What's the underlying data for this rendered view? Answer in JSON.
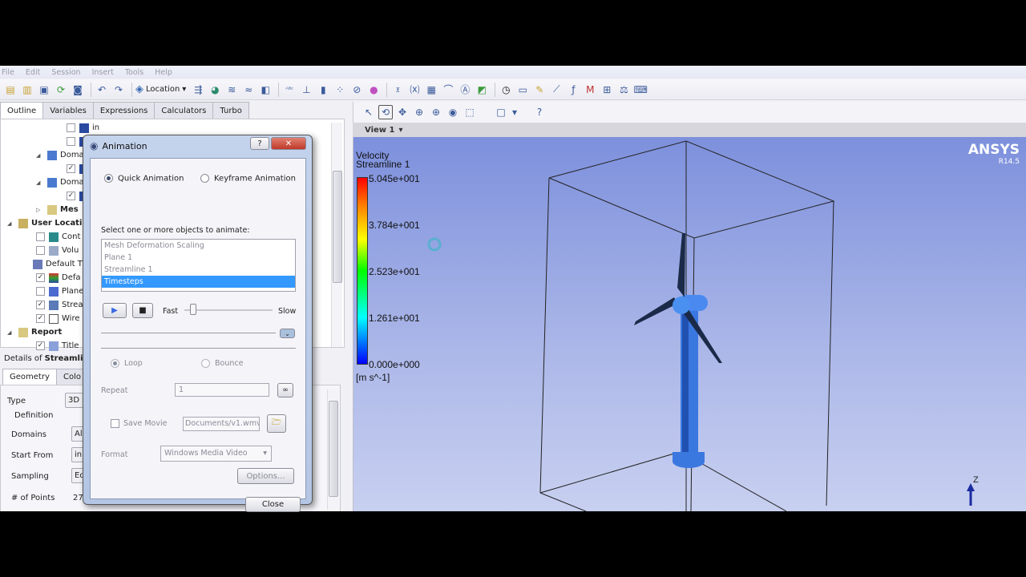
{
  "menu": [
    "File",
    "Edit",
    "Session",
    "Insert",
    "Tools",
    "Help"
  ],
  "toolbar": {
    "location_label": "Location"
  },
  "tabs": [
    "Outline",
    "Variables",
    "Expressions",
    "Calculators",
    "Turbo"
  ],
  "tree": [
    {
      "label": "in",
      "checked": false
    },
    {
      "label": "",
      "checked": false
    },
    {
      "label": "Doma",
      "expander": "open"
    },
    {
      "label": "",
      "checked": true
    },
    {
      "label": "Doma",
      "expander": "open"
    },
    {
      "label": "",
      "checked": true
    },
    {
      "label": "Mes",
      "expander": "closed",
      "bold": true
    },
    {
      "label": "User Locati",
      "expander": "open",
      "bold": true
    },
    {
      "label": "Cont",
      "checked": false
    },
    {
      "label": "Volu",
      "checked": false
    },
    {
      "label": "Default T"
    },
    {
      "label": "Defa",
      "checked": true
    },
    {
      "label": "Plane",
      "checked": false
    },
    {
      "label": "Strea",
      "checked": true
    },
    {
      "label": "Wire",
      "checked": true
    },
    {
      "label": "Report",
      "expander": "open",
      "bold": true
    },
    {
      "label": "Title",
      "checked": true
    }
  ],
  "details": {
    "title_prefix": "Details of ",
    "title_bold": "Streamlin",
    "tabs": [
      "Geometry",
      "Colo"
    ],
    "props": [
      {
        "label": "Type",
        "value": "3D S"
      },
      {
        "label": "Definition",
        "value": ""
      },
      {
        "label": "Domains",
        "value": "All"
      },
      {
        "label": "Start From",
        "value": "in"
      },
      {
        "label": "Sampling",
        "value": "Eq"
      },
      {
        "label": "# of Points",
        "value": "27"
      }
    ]
  },
  "viewer": {
    "view_label": "View 1"
  },
  "legend": {
    "title": "Velocity",
    "subtitle": "Streamline 1",
    "ticks": [
      "5.045e+001",
      "3.784e+001",
      "2.523e+001",
      "1.261e+001",
      "0.000e+000"
    ],
    "units": "[m s^-1]"
  },
  "brand": {
    "name": "ANSYS",
    "version": "R14.5"
  },
  "axis_label": "Z",
  "dialog": {
    "title": "Animation",
    "mode_quick": "Quick Animation",
    "mode_keyframe": "Keyframe Animation",
    "select_label": "Select one or more objects to animate:",
    "objects": [
      "Mesh Deformation Scaling",
      "Plane 1",
      "Streamline 1",
      "Timesteps"
    ],
    "selected_object": "Timesteps",
    "speed_fast": "Fast",
    "speed_slow": "Slow",
    "speed_value": 0.1,
    "loop": "Loop",
    "bounce": "Bounce",
    "repeat_label": "Repeat",
    "repeat_value": "1",
    "save_movie": "Save Movie",
    "save_path": "Documents/v1.wmv",
    "format_label": "Format",
    "format_value": "Windows Media Video",
    "options_btn": "Options...",
    "close_btn": "Close"
  }
}
